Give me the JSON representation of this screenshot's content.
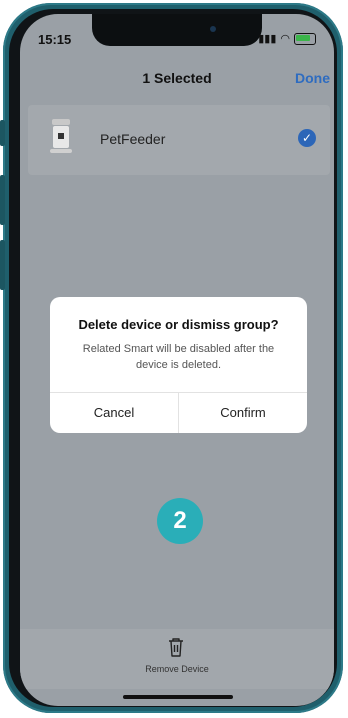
{
  "status": {
    "time": "15:15"
  },
  "header": {
    "title": "1 Selected",
    "done_label": "Done"
  },
  "devices": [
    {
      "name": "PetFeeder",
      "selected": true
    }
  ],
  "dialog": {
    "title": "Delete device or dismiss group?",
    "message": "Related Smart will be disabled after the device is deleted.",
    "cancel_label": "Cancel",
    "confirm_label": "Confirm"
  },
  "step_badge": "2",
  "bottom_bar": {
    "remove_label": "Remove Device"
  },
  "colors": {
    "accent": "#2e6cc0",
    "badge": "#2aaeb8",
    "frame": "#1f5f6c"
  }
}
